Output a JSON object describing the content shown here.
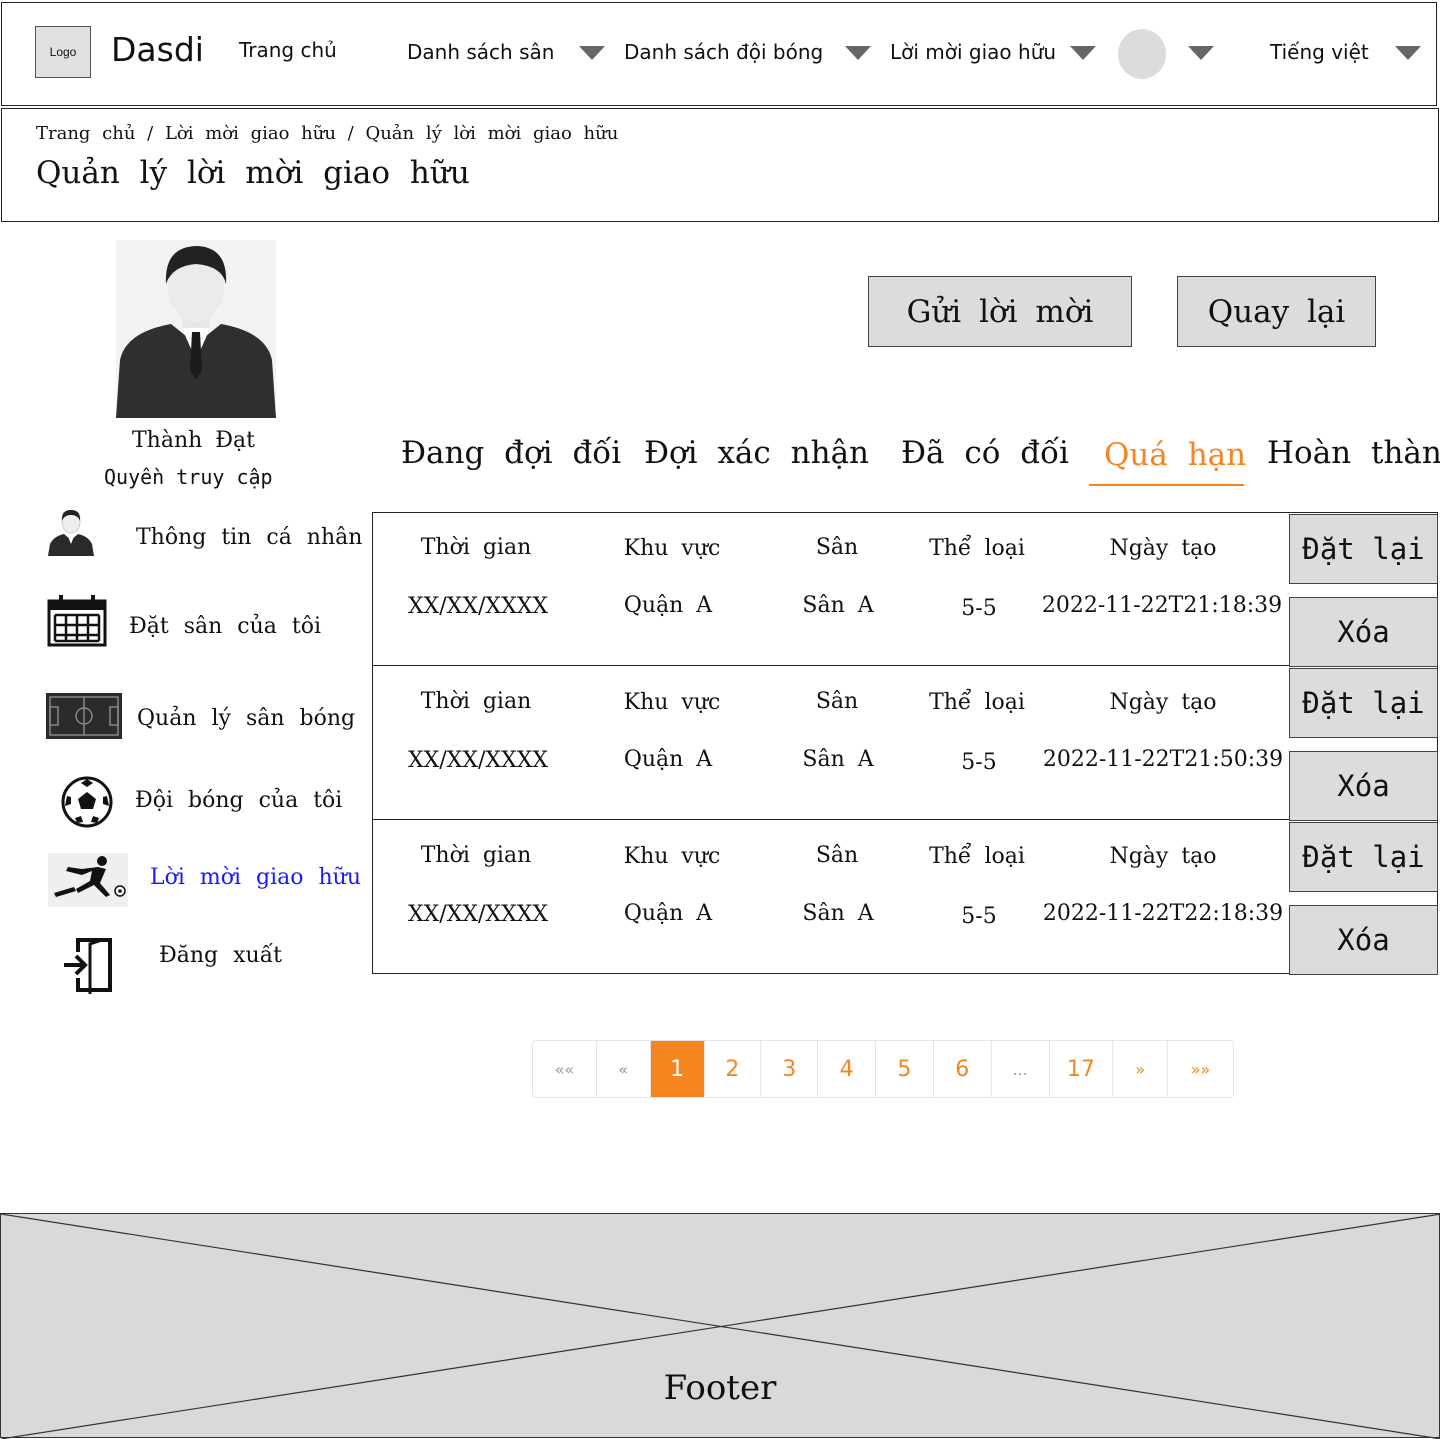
{
  "header": {
    "logo_text": "Logo",
    "brand": "Dasdi",
    "nav": {
      "home": "Trang chủ",
      "fields": "Danh sách sân",
      "teams": "Danh sách đội bóng",
      "invites": "Lời mời giao hữu",
      "language": "Tiếng việt"
    }
  },
  "breadcrumb": "Trang chủ / Lời mời giao hữu / Quản lý lời mời giao hữu",
  "page_title": "Quản lý lời mời giao hữu",
  "profile": {
    "name": "Thành Đạt",
    "role": "Quyền truy cập"
  },
  "sidebar": {
    "items": [
      {
        "label": "Thông tin cá nhân",
        "icon": "person-icon"
      },
      {
        "label": "Đặt sân của tôi",
        "icon": "calendar-icon"
      },
      {
        "label": "Quản lý sân bóng",
        "icon": "football-field-icon"
      },
      {
        "label": "Đội bóng của tôi",
        "icon": "soccer-ball-icon"
      },
      {
        "label": "Lời mời giao hữu",
        "icon": "soccer-player-icon",
        "active": true
      },
      {
        "label": "Đăng xuất",
        "icon": "logout-icon"
      }
    ]
  },
  "actions": {
    "send_invite": "Gửi lời mời",
    "back": "Quay lại"
  },
  "tabs": [
    "Đang đợi đối",
    "Đợi xác nhận",
    "Đã có đối",
    "Quá hạn",
    "Hoàn thành"
  ],
  "active_tab": "Quá hạn",
  "table": {
    "headers": [
      "Thời gian",
      "Khu vực",
      "Sân",
      "Thể loại",
      "Ngày tạo"
    ],
    "rows": [
      [
        "XX/XX/XXXX",
        "Quận A",
        "Sân A",
        "5-5",
        "2022-11-22T21:18:39"
      ],
      [
        "XX/XX/XXXX",
        "Quận A",
        "Sân A",
        "5-5",
        "2022-11-22T21:50:39"
      ],
      [
        "XX/XX/XXXX",
        "Quận A",
        "Sân A",
        "5-5",
        "2022-11-22T22:18:39"
      ]
    ],
    "reset_label": "Đặt lại",
    "delete_label": "Xóa"
  },
  "pagination": {
    "first": "««",
    "prev": "«",
    "pages": [
      "1",
      "2",
      "3",
      "4",
      "5",
      "6",
      "...",
      "17"
    ],
    "current": "1",
    "next": "»",
    "last": "»»"
  },
  "footer": {
    "label": "Footer"
  },
  "colors": {
    "accent": "#f5861f",
    "active_link": "#1a1aff",
    "button_bg": "#dcdcdc"
  }
}
